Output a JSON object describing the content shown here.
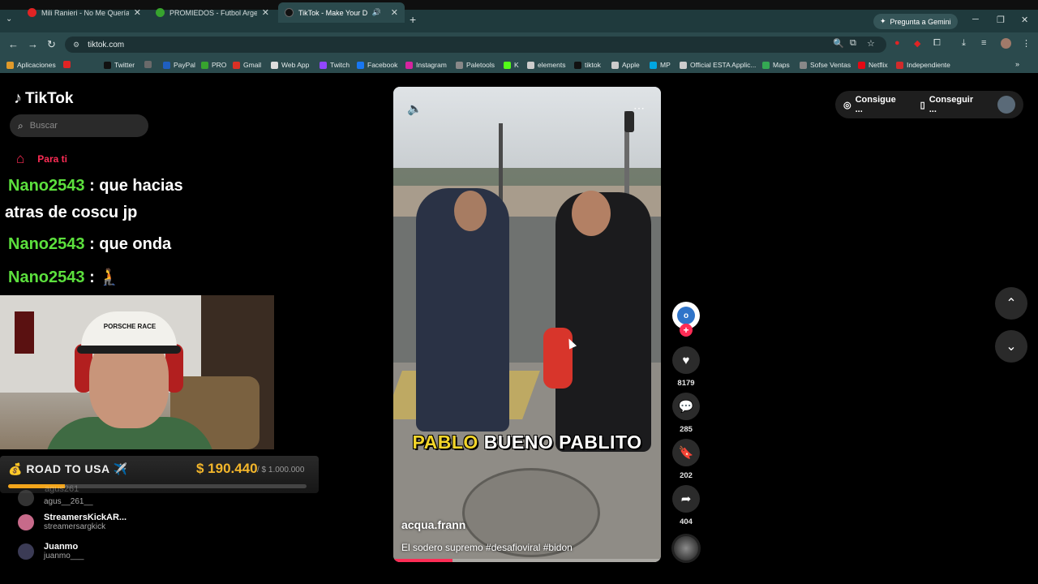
{
  "browser": {
    "tabs": [
      {
        "title": "Mili Ranieri - No Me Querías A",
        "color": "#e02424"
      },
      {
        "title": "PROMIEDOS - Futbol Argentin",
        "color": "#37a32e"
      },
      {
        "title": "TikTok - Make Your Day",
        "color": "#111111"
      }
    ],
    "gemini_label": "Pregunta a Gemini",
    "url": "tiktok.com",
    "bookmarks": [
      {
        "label": "Aplicaciones",
        "color": "#e09a2a"
      },
      {
        "label": "",
        "color": "#e02424"
      },
      {
        "label": "Twitter",
        "color": "#111111"
      },
      {
        "label": "",
        "color": "#6a6a6a"
      },
      {
        "label": "PayPal",
        "color": "#1f5fbf"
      },
      {
        "label": "PRO",
        "color": "#37a32e"
      },
      {
        "label": "Gmail",
        "color": "#d93025"
      },
      {
        "label": "Web App",
        "color": "#dddddd"
      },
      {
        "label": "Twitch",
        "color": "#9146ff"
      },
      {
        "label": "Facebook",
        "color": "#1877f2"
      },
      {
        "label": "Instagram",
        "color": "#d6249f"
      },
      {
        "label": "Paletools",
        "color": "#888888"
      },
      {
        "label": "K",
        "color": "#53fc18"
      },
      {
        "label": "elements",
        "color": "#cccccc"
      },
      {
        "label": "tiktok",
        "color": "#111111"
      },
      {
        "label": "Apple",
        "color": "#cccccc"
      },
      {
        "label": "MP",
        "color": "#00a6e0"
      },
      {
        "label": "Official ESTA Applic...",
        "color": "#cccccc"
      },
      {
        "label": "Maps",
        "color": "#34a853"
      },
      {
        "label": "Sofse Ventas",
        "color": "#888888"
      },
      {
        "label": "Netflix",
        "color": "#e50914"
      },
      {
        "label": "Independiente",
        "color": "#d12b2b"
      }
    ]
  },
  "tiktok": {
    "logo": "TikTok",
    "search_placeholder": "Buscar",
    "nav_foryou": "Para ti",
    "topbar": {
      "btn1": "Consigue ...",
      "btn2": "Conseguir ..."
    },
    "accounts": [
      {
        "name": "",
        "handle": "agus__261__",
        "color": "#555555"
      },
      {
        "name": "StreamersKickAR...",
        "handle": "streamersargkick",
        "color": "#c76a8a"
      },
      {
        "name": "Juanmo",
        "handle": "juanmo___",
        "color": "#3b3b55"
      }
    ],
    "ghost_handle": "agus261",
    "video": {
      "caption_yellow": "PABLO",
      "caption_white": "BUENO PABLITO",
      "author": "acqua.frann",
      "description": "El sodero supremo #desafioviral #bidon",
      "progress": 0.22,
      "avatar_letter": "o"
    },
    "actions": {
      "likes": "8179",
      "comments": "285",
      "saves": "202",
      "shares": "404"
    }
  },
  "overlay": {
    "chat": [
      {
        "user": "Nano2543",
        "msg": ": que hacias",
        "cont": "atras de coscu jp"
      },
      {
        "user": "Nano2543",
        "msg": ": que onda"
      },
      {
        "user": "Nano2543",
        "msg": ": 🧎"
      }
    ],
    "cap_text": "PORSCHE RACE",
    "road_title": "💰 ROAD TO USA ✈️",
    "amount": "$ 190.440",
    "goal": "/ $ 1.000.000",
    "goal_progress": 0.19
  }
}
